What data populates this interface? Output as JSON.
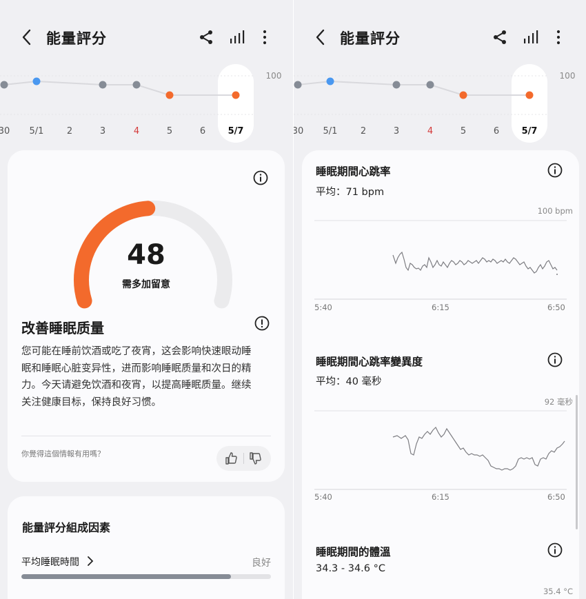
{
  "header": {
    "title": "能量評分"
  },
  "trend": {
    "ymax_label": "100",
    "dates": [
      "30",
      "5/1",
      "2",
      "3",
      "4",
      "5",
      "6",
      "5/7"
    ],
    "points": [
      {
        "date": "30",
        "level": "mid",
        "color": "#868c96"
      },
      {
        "date": "5/1",
        "level": "high",
        "color": "#4a98f0"
      },
      {
        "date": "3",
        "level": "mid",
        "color": "#868c96"
      },
      {
        "date": "4",
        "level": "mid",
        "color": "#868c96"
      },
      {
        "date": "5",
        "level": "low",
        "color": "#f36a2c"
      },
      {
        "date": "5/7",
        "level": "low",
        "color": "#f36a2c"
      }
    ],
    "highlight_date": "5/7",
    "red_date": "4"
  },
  "score": {
    "value": "48",
    "value_number": 48,
    "label": "需多加留意",
    "gauge_color": "#f36a2c"
  },
  "insight": {
    "title": "改善睡眠质量",
    "lines": [
      "您可能在睡前饮酒或吃了夜宵，这会影响快速眼动睡",
      "眠和睡眠心脏变异性，进而影响睡眠质量和次日的精",
      "力。今天请避免饮酒和夜宵，以提高睡眠质量。继续",
      "关注健康目标，保持良好习惯。"
    ],
    "feedback_question": "你覺得這個情報有用嗎？"
  },
  "factors": {
    "title": "能量評分組成因素",
    "item_label": "平均睡眠時間",
    "item_status": "良好",
    "item_progress": 0.84
  },
  "heart_rate": {
    "title": "睡眠期間心跳率",
    "avg": "平均：71 bpm",
    "ymax": "100 bpm",
    "x_labels": [
      "5:40",
      "6:15",
      "6:50"
    ]
  },
  "hrv": {
    "title": "睡眠期間心跳率變異度",
    "avg": "平均：40 毫秒",
    "ymax": "92 毫秒",
    "x_labels": [
      "5:40",
      "6:15",
      "6:50"
    ]
  },
  "temp": {
    "title": "睡眠期間的體溫",
    "range": "34.3 - 34.6 °C",
    "ymax": "35.4 °C"
  },
  "colors": {
    "accent": "#f36a2c",
    "blue_point": "#4a98f0",
    "grey_point": "#868c96",
    "red_date": "#d43a3a"
  }
}
